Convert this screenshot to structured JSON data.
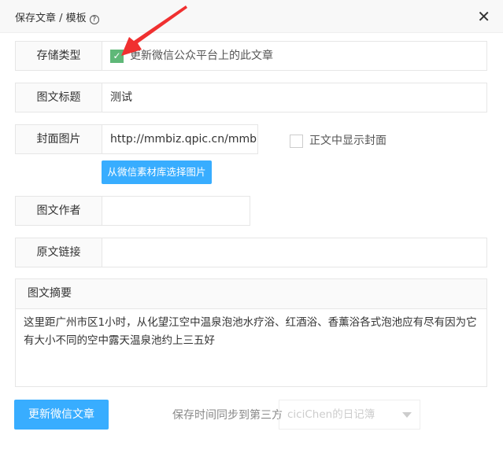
{
  "dialog": {
    "title": "保存文章 / 模板",
    "help_icon": "?",
    "close_icon": "✕"
  },
  "fields": {
    "storage_type": {
      "label": "存储类型",
      "checkbox_label": "更新微信公众平台上的此文章",
      "checked": true
    },
    "title": {
      "label": "图文标题",
      "value": "测试"
    },
    "cover": {
      "label": "封面图片",
      "value": "http://mmbiz.qpic.cn/mmbiz_jp",
      "show_cover_label": "正文中显示封面",
      "show_cover_checked": false,
      "choose_button": "从微信素材库选择图片"
    },
    "author": {
      "label": "图文作者",
      "value": ""
    },
    "source_link": {
      "label": "原文链接",
      "value": ""
    },
    "summary": {
      "label": "图文摘要",
      "value": "这里距广州市区1小时，从化望江空中温泉泡池水疗浴、红酒浴、香薰浴各式泡池应有尽有因为它有大小不同的空中露天温泉池约上三五好"
    }
  },
  "footer": {
    "submit_button": "更新微信文章",
    "sync_label": "保存时间同步到第三方",
    "sync_select": "ciciChen的日记簿"
  },
  "colors": {
    "accent": "#38adff",
    "check": "#5fb878",
    "annotation_arrow": "#f03030"
  }
}
